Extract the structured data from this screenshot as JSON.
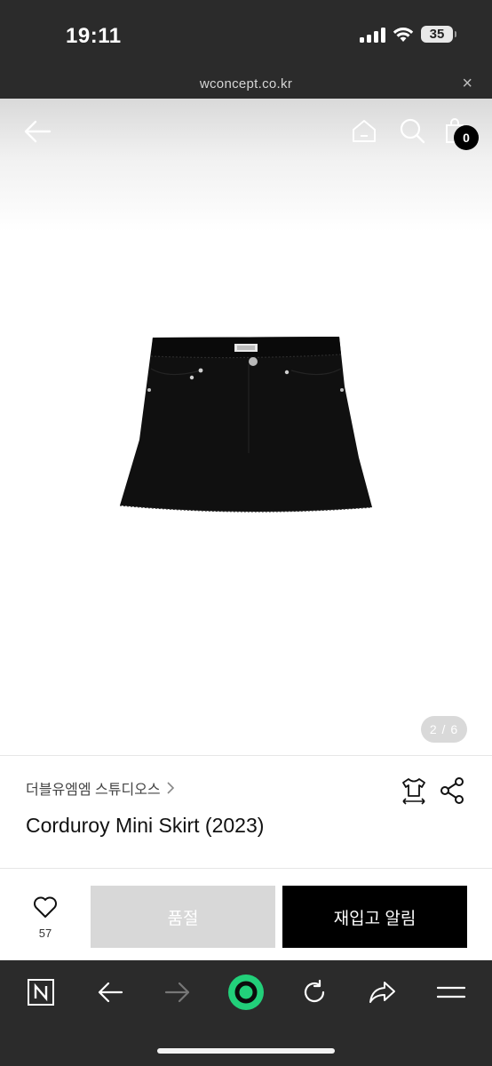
{
  "status_bar": {
    "time": "19:11",
    "battery": "35"
  },
  "browser": {
    "url": "wconcept.co.kr",
    "close_label": "×"
  },
  "header": {
    "cart_count": "0"
  },
  "gallery": {
    "indicator": "2 / 6"
  },
  "product": {
    "brand": "더블유엠엠 스튜디오스",
    "name": "Corduroy Mini Skirt (2023)"
  },
  "actions": {
    "like_count": "57",
    "soldout_label": "품절",
    "restock_label": "재입고 알림"
  },
  "colors": {
    "dark_bar": "#2b2b2b",
    "primary_button": "#000000",
    "disabled_button": "#d8d8d8",
    "toolbar_accent": "#22d07a"
  },
  "icons": [
    "back-arrow-icon",
    "home-icon",
    "search-icon",
    "shopping-bag-icon",
    "size-guide-icon",
    "share-icon",
    "heart-icon",
    "naver-n-icon",
    "reload-icon",
    "forward-share-icon",
    "menu-icon"
  ]
}
